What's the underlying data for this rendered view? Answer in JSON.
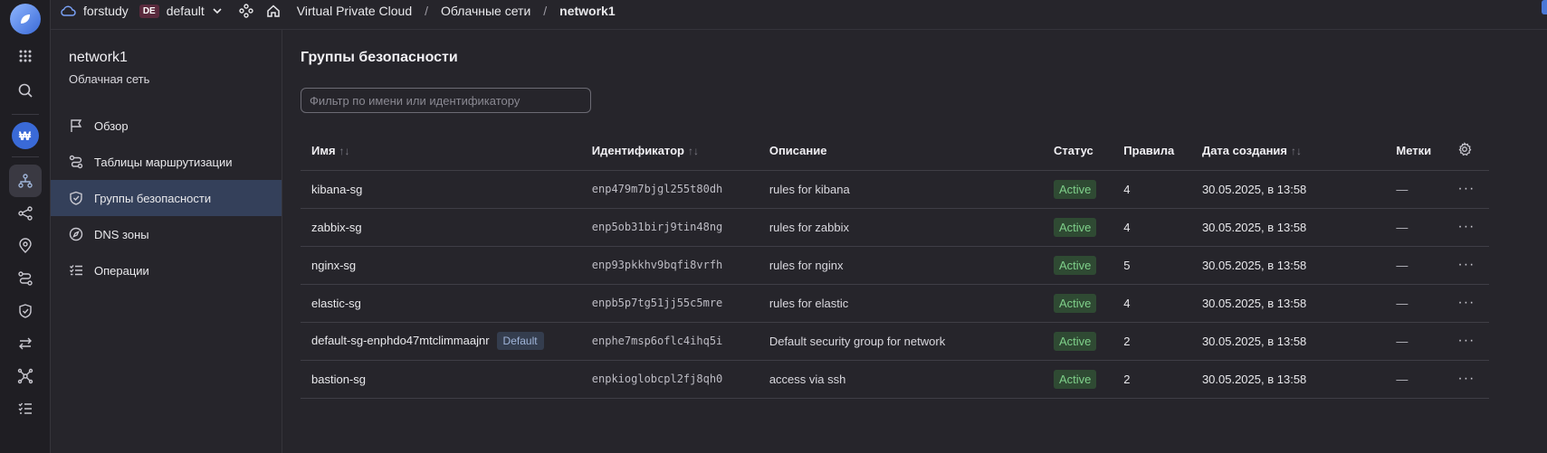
{
  "topbar": {
    "cloud_name": "forstudy",
    "cloud_badge": "DE",
    "folder": "default",
    "breadcrumbs": [
      "Virtual Private Cloud",
      "Облачные сети",
      "network1"
    ]
  },
  "rail": {
    "workspace_letter": "₩",
    "icons": [
      "grid-icon",
      "search-icon",
      "network-icon",
      "share-icon",
      "location-icon",
      "routes-icon",
      "shield-icon",
      "transfer-icon",
      "nodes-icon",
      "list-icon"
    ]
  },
  "sidenav": {
    "title": "network1",
    "subtitle": "Облачная сеть",
    "items": [
      {
        "label": "Обзор",
        "icon": "flag-icon"
      },
      {
        "label": "Таблицы маршрутизации",
        "icon": "routes-icon"
      },
      {
        "label": "Группы безопасности",
        "icon": "shield-icon"
      },
      {
        "label": "DNS зоны",
        "icon": "compass-icon"
      },
      {
        "label": "Операции",
        "icon": "list-icon"
      }
    ],
    "active_index": 2
  },
  "main": {
    "title": "Группы безопасности",
    "filter_placeholder": "Фильтр по имени или идентификатору",
    "columns": {
      "name": "Имя",
      "id": "Идентификатор",
      "description": "Описание",
      "status": "Статус",
      "rules": "Правила",
      "created": "Дата создания",
      "labels": "Метки"
    },
    "sort_glyph": "↑↓",
    "rows": [
      {
        "name": "kibana-sg",
        "tag": "",
        "id": "enp479m7bjgl255t80dh",
        "description": "rules for kibana",
        "status": "Active",
        "rules": "4",
        "created": "30.05.2025, в 13:58",
        "labels": "—"
      },
      {
        "name": "zabbix-sg",
        "tag": "",
        "id": "enp5ob31birj9tin48ng",
        "description": "rules for zabbix",
        "status": "Active",
        "rules": "4",
        "created": "30.05.2025, в 13:58",
        "labels": "—"
      },
      {
        "name": "nginx-sg",
        "tag": "",
        "id": "enp93pkkhv9bqfi8vrfh",
        "description": "rules for nginx",
        "status": "Active",
        "rules": "5",
        "created": "30.05.2025, в 13:58",
        "labels": "—"
      },
      {
        "name": "elastic-sg",
        "tag": "",
        "id": "enpb5p7tg51jj55c5mre",
        "description": "rules for elastic",
        "status": "Active",
        "rules": "4",
        "created": "30.05.2025, в 13:58",
        "labels": "—"
      },
      {
        "name": "default-sg-enphdo47mtclimmaajnr",
        "tag": "Default",
        "id": "enphe7msp6oflc4ihq5i",
        "description": "Default security group for network",
        "status": "Active",
        "rules": "2",
        "created": "30.05.2025, в 13:58",
        "labels": "—"
      },
      {
        "name": "bastion-sg",
        "tag": "",
        "id": "enpkioglobcpl2fj8qh0",
        "description": "access via ssh",
        "status": "Active",
        "rules": "2",
        "created": "30.05.2025, в 13:58",
        "labels": "—"
      }
    ],
    "row_menu_glyph": "···"
  },
  "colors": {
    "background": "#26252b",
    "rail": "#1f1e23",
    "active_nav": "#34405a",
    "status_active": "#7fd08a",
    "accent": "#3a6ad7"
  }
}
